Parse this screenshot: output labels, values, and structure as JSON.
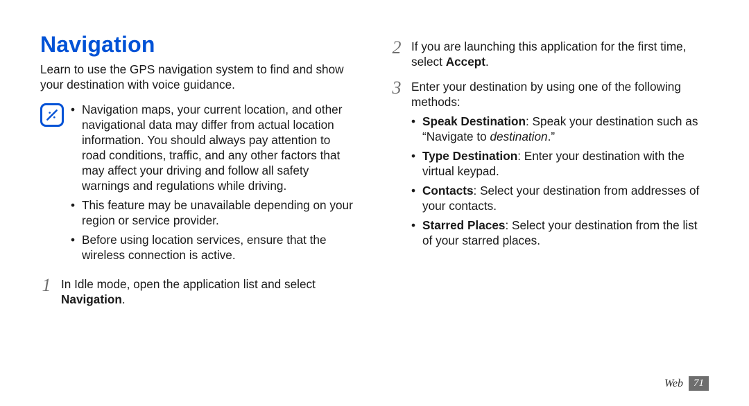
{
  "left": {
    "title": "Navigation",
    "intro": "Learn to use the GPS navigation system to find and show your destination with voice guidance.",
    "notes": [
      "Navigation maps, your current location, and other navigational data may differ from actual location information. You should always pay attention to road conditions, traffic, and any other factors that may affect your driving and follow all safety warnings and regulations while driving.",
      "This feature may be unavailable depending on your region or service provider.",
      "Before using location services, ensure that the wireless connection is active."
    ],
    "step1_num": "1",
    "step1_pre": "In Idle mode, open the application list and select ",
    "step1_bold": "Navigation",
    "step1_post": "."
  },
  "right": {
    "step2_num": "2",
    "step2_pre": "If you are launching this application for the first time, select ",
    "step2_bold": "Accept",
    "step2_post": ".",
    "step3_num": "3",
    "step3_text": "Enter your destination by using one of the following methods:",
    "methods": [
      {
        "bold": "Speak Destination",
        "text_pre": ": Speak your destination such as “Navigate to ",
        "ital": "destination",
        "text_post": ".”"
      },
      {
        "bold": "Type Destination",
        "text_pre": ": Enter your destination with the virtual keypad.",
        "ital": "",
        "text_post": ""
      },
      {
        "bold": "Contacts",
        "text_pre": ": Select your destination from addresses of your contacts.",
        "ital": "",
        "text_post": ""
      },
      {
        "bold": "Starred Places",
        "text_pre": ": Select your destination from the list of your starred places.",
        "ital": "",
        "text_post": ""
      }
    ]
  },
  "footer": {
    "section": "Web",
    "page": "71"
  }
}
